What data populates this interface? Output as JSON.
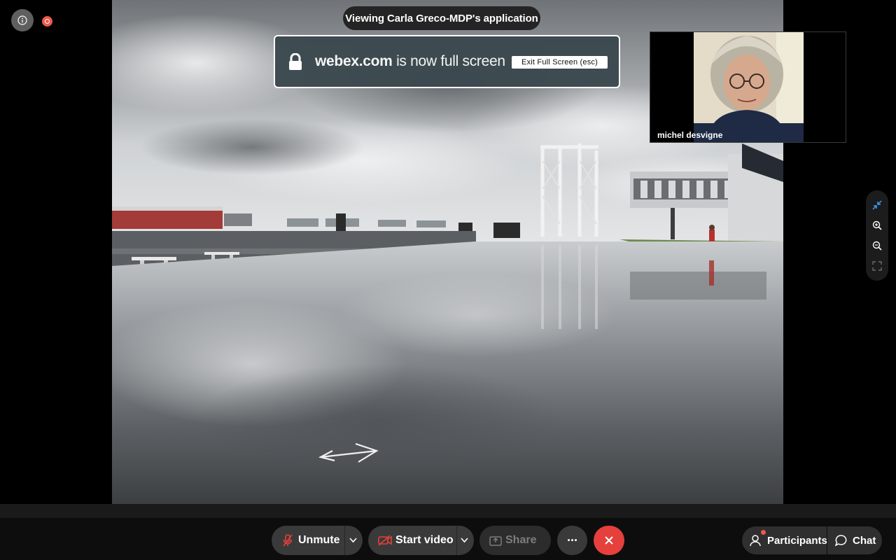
{
  "meeting": {
    "viewing_text": "Viewing Carla Greco-MDP's application",
    "fullscreen_banner": {
      "domain": "webex.com",
      "message": "is now full screen",
      "exit_button": "Exit Full Screen (esc)"
    }
  },
  "participant_video": {
    "name": "michel desvigne"
  },
  "toolbar": {
    "unmute_label": "Unmute",
    "start_video_label": "Start video",
    "share_label": "Share",
    "more_label": "···",
    "participants_label": "Participants",
    "chat_label": "Chat"
  },
  "colors": {
    "end_call": "#e5403b",
    "recording": "#f0574b",
    "muted_icon": "#e5403b"
  },
  "icons": {
    "info": "info-icon",
    "recording": "recording-indicator-icon",
    "lock": "lock-icon",
    "microphone_muted": "microphone-muted-icon",
    "camera_off": "camera-off-icon",
    "share": "share-icon",
    "more": "more-icon",
    "end": "end-call-icon",
    "participants": "participants-icon",
    "chat": "chat-icon",
    "exit_fullscreen": "collapse-icon",
    "zoom_in": "zoom-in-icon",
    "zoom_out": "zoom-out-icon",
    "fit": "fit-screen-icon"
  }
}
